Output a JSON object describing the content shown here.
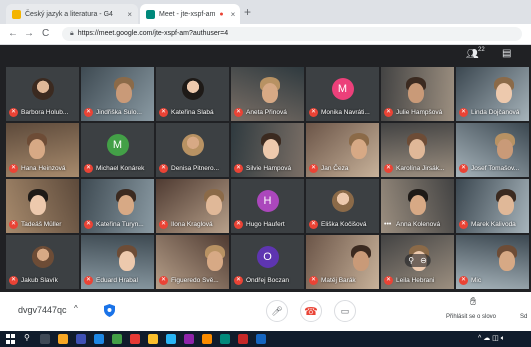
{
  "tabs": [
    {
      "title": "Český jazyk a literatura - G4",
      "close": "×"
    },
    {
      "title": "Meet - jte-xspf-am",
      "close": "×"
    }
  ],
  "new_tab": "+",
  "address": "https://meet.google.com/jte-xspf-am?authuser=4",
  "people_count": "22",
  "participants": [
    {
      "name": "Barbora Holub...",
      "avatar_color": "#8d6e63",
      "kind": "photo"
    },
    {
      "name": "Jindřiška Sulo...",
      "kind": "video"
    },
    {
      "name": "Kateřina Slabá",
      "kind": "photo"
    },
    {
      "name": "Aneta Přinová",
      "kind": "video"
    },
    {
      "name": "Monika Navráti...",
      "initial": "M",
      "avatar_color": "#ec407a",
      "kind": "letter"
    },
    {
      "name": "Julie Hampšová",
      "kind": "video"
    },
    {
      "name": "Linda Dojčanová",
      "kind": "video"
    },
    {
      "name": "Hana Heinzová",
      "kind": "video"
    },
    {
      "name": "Michael Konárek",
      "initial": "M",
      "avatar_color": "#43a047",
      "kind": "letter"
    },
    {
      "name": "Denisa Pitnero...",
      "kind": "photo"
    },
    {
      "name": "Silvie Hampová",
      "kind": "video"
    },
    {
      "name": "Jan Čeza",
      "kind": "video"
    },
    {
      "name": "Karolína Jirsák...",
      "kind": "video"
    },
    {
      "name": "Josef Tomašov...",
      "kind": "video"
    },
    {
      "name": "Tadeáš Müller",
      "kind": "video"
    },
    {
      "name": "Kateřina Turyn...",
      "kind": "video"
    },
    {
      "name": "Ilona Kraglová",
      "kind": "video"
    },
    {
      "name": "Hugo Haufert",
      "initial": "H",
      "avatar_color": "#ab47bc",
      "kind": "letter"
    },
    {
      "name": "Eliška Kočišová",
      "kind": "photo"
    },
    {
      "name": "Anna Kolenová",
      "kind": "video",
      "speaking": true
    },
    {
      "name": "Marek Kalivoda",
      "kind": "video"
    },
    {
      "name": "Jakub Slavík",
      "kind": "photo"
    },
    {
      "name": "Eduard Hrabal",
      "kind": "video"
    },
    {
      "name": "Figueredo Svě...",
      "kind": "video"
    },
    {
      "name": "Ondřej Boczan",
      "initial": "O",
      "avatar_color": "#5e35b1",
      "kind": "letter"
    },
    {
      "name": "Matěj Barák",
      "kind": "video"
    },
    {
      "name": "Leila Hebrani",
      "kind": "video"
    },
    {
      "name": "Mic",
      "kind": "video"
    }
  ],
  "bottom": {
    "meeting_code": "dvgv7447qc",
    "raise_hand_label": "Přihlásit se o slovo",
    "extra_label": "Sd"
  }
}
